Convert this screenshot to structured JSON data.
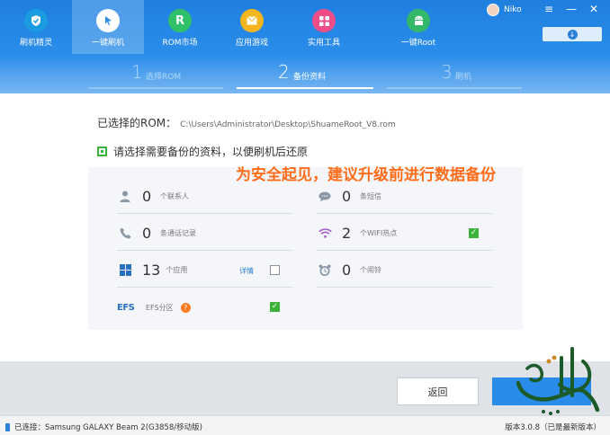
{
  "nav": [
    {
      "label": "刷机精灵",
      "icon": "shield-icon",
      "color": "#1b9be0"
    },
    {
      "label": "一键刷机",
      "icon": "cursor-icon",
      "color": "#2d8de6"
    },
    {
      "label": "ROM市场",
      "icon": "rom-icon",
      "glyph": "R",
      "color": "#2fc06a"
    },
    {
      "label": "应用游戏",
      "icon": "mail-icon",
      "color": "#f5b51f"
    },
    {
      "label": "实用工具",
      "icon": "grid-icon",
      "color": "#ee4d8a"
    },
    {
      "label": "一键Root",
      "icon": "android-icon",
      "color": "#33b86a"
    }
  ],
  "user": {
    "name": "Niko"
  },
  "steps": [
    {
      "num": "1",
      "label": "选择ROM"
    },
    {
      "num": "2",
      "label": "备份资料"
    },
    {
      "num": "3",
      "label": "刷机"
    }
  ],
  "rom": {
    "label": "已选择的ROM：",
    "path": "C:\\Users\\Administrator\\Desktop\\ShuameRoot_V8.rom"
  },
  "hint": "请选择需要备份的资料，以便刷机后还原",
  "warning": "为安全起见，建议升级前进行数据备份",
  "backup_items": {
    "contacts": {
      "count": "0",
      "label": "个联系人",
      "icon": "person-icon"
    },
    "sms": {
      "count": "0",
      "label": "条短信",
      "icon": "message-icon"
    },
    "calls": {
      "count": "0",
      "label": "条通话记录",
      "icon": "phone-icon"
    },
    "wifi": {
      "count": "2",
      "label": "个WIFI热点",
      "icon": "wifi-icon",
      "checked": true
    },
    "apps": {
      "count": "13",
      "label": "个应用",
      "icon": "apps-icon",
      "detail": "详情",
      "checked": false
    },
    "alarms": {
      "count": "0",
      "label": "个闹铃",
      "icon": "alarm-icon"
    },
    "efs": {
      "tag": "EFS",
      "label": "EFS分区",
      "help": "?",
      "checked": true
    }
  },
  "buttons": {
    "back": "返回"
  },
  "status": {
    "connected": "已连接：Samsung GALAXY Beam 2(G3858/移动版)",
    "version": "版本3.0.8（已是最新版本）"
  }
}
